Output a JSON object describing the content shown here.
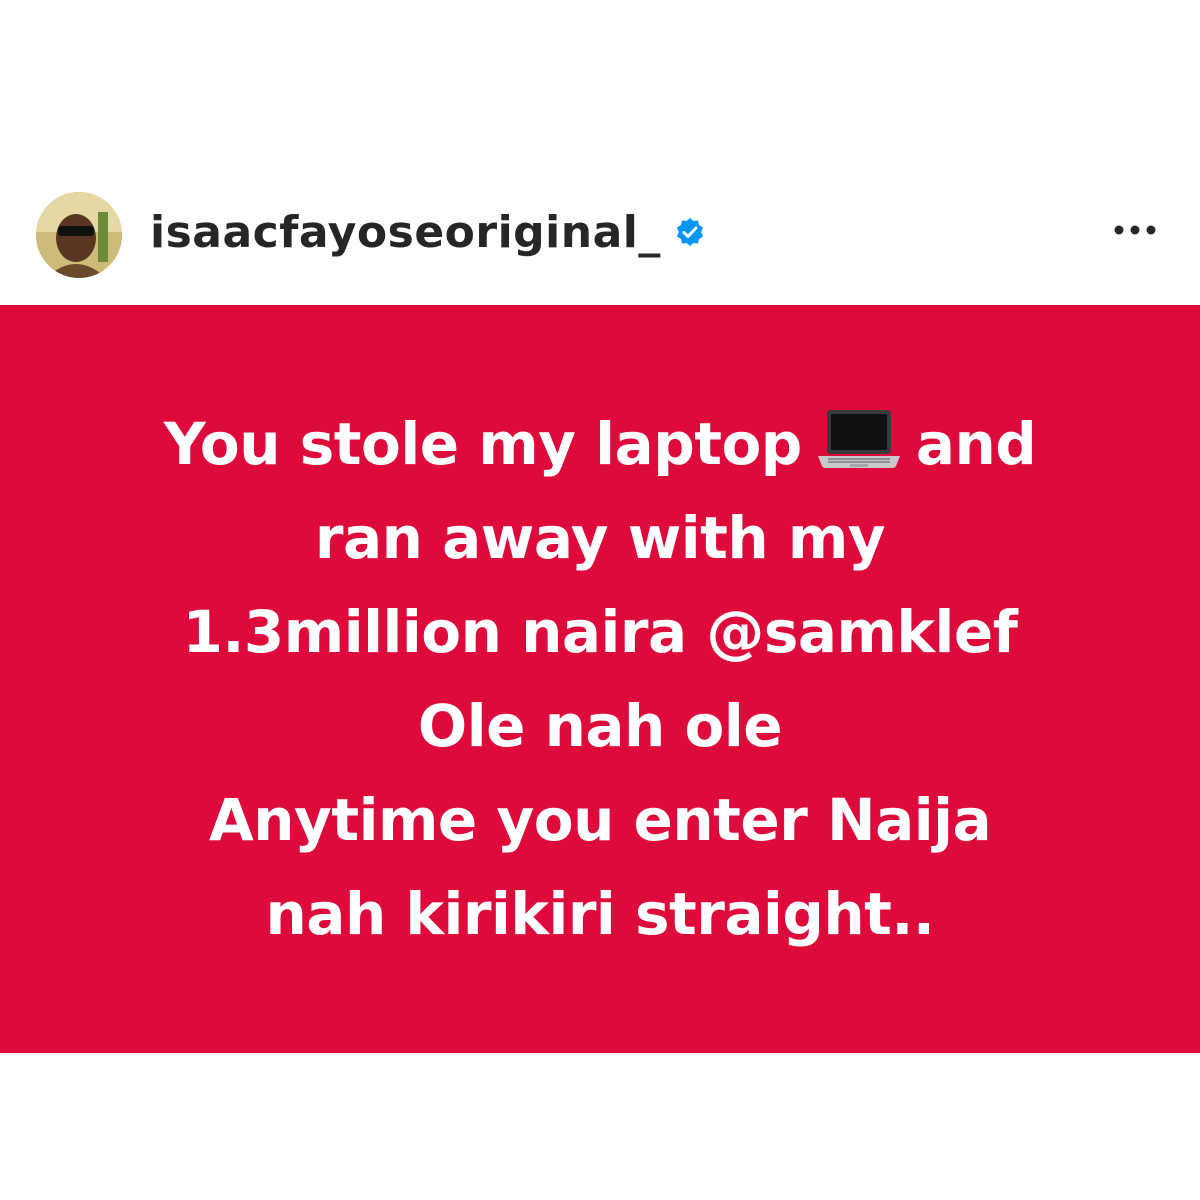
{
  "post": {
    "username": "isaacfayoseoriginal_",
    "verified": true,
    "icons": {
      "avatar": "profile-photo",
      "verified": "verified-badge-icon",
      "more": "more-options-icon",
      "laptop": "laptop-emoji"
    },
    "image": {
      "background_color": "#dd0a3b",
      "text_color": "#ffffff",
      "lines": {
        "l1a": "You stole my laptop",
        "l1b": "and",
        "l2": "ran away with my",
        "l3": "1.3million naira @samklef",
        "l4": "Ole nah ole",
        "l5": "Anytime you enter Naija",
        "l6": "nah kirikiri straight.."
      }
    }
  }
}
